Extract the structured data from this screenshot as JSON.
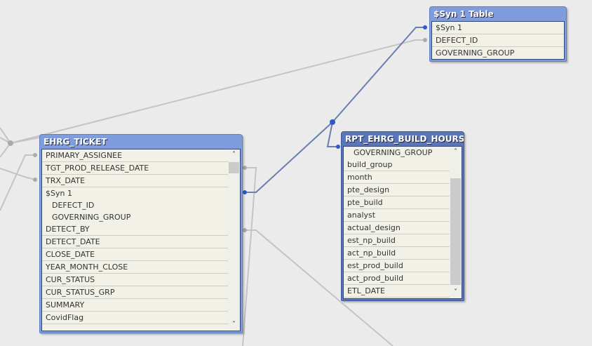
{
  "tables": {
    "syn": {
      "title": "$Syn 1 Table",
      "fields": [
        "$Syn 1",
        "DEFECT_ID",
        "GOVERNING_GROUP"
      ]
    },
    "ehrg": {
      "title": "EHRG_TICKET",
      "fields": [
        "PRIMARY_ASSIGNEE",
        "TGT_PROD_RELEASE_DATE",
        "TRX_DATE",
        "$Syn 1",
        "DEFECT_ID",
        "GOVERNING_GROUP",
        "DETECT_BY",
        "DETECT_DATE",
        "CLOSE_DATE",
        "YEAR_MONTH_CLOSE",
        "CUR_STATUS",
        "CUR_STATUS_GRP",
        "SUMMARY",
        "CovidFlag"
      ]
    },
    "rpt": {
      "title": "RPT_EHRG_BUILD_HOURS",
      "fields": [
        "GOVERNING_GROUP",
        "build_group",
        "month",
        "pte_design",
        "pte_build",
        "analyst",
        "actual_design",
        "est_np_build",
        "act_np_build",
        "est_prod_build",
        "act_prod_build",
        "ETL_DATE"
      ]
    }
  },
  "icons": {
    "scroll_up": "chevron-up-icon",
    "scroll_down": "chevron-down-icon"
  },
  "colors": {
    "active_header": "#5b76b8",
    "inactive_header": "#7f9ddc",
    "link_key": "#6a7fb0",
    "link_field": "#c4c4c4"
  }
}
